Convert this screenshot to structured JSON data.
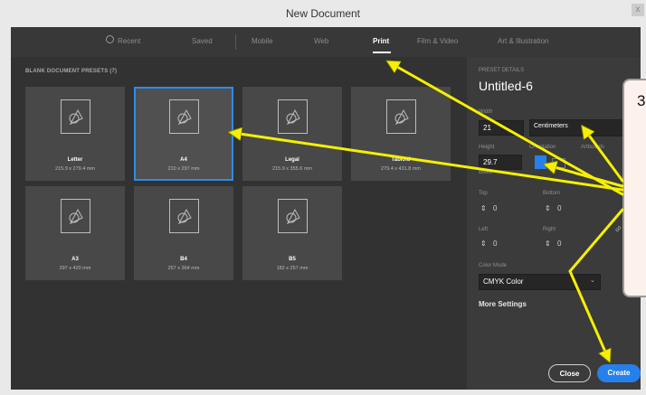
{
  "window": {
    "title": "New Document",
    "close_label": "x"
  },
  "tabs": [
    {
      "label": "Recent",
      "icon": "clock-icon"
    },
    {
      "label": "Saved"
    },
    {
      "label": "Mobile"
    },
    {
      "label": "Web"
    },
    {
      "label": "Print",
      "active": true
    },
    {
      "label": "Film & Video"
    },
    {
      "label": "Art & Illustration"
    }
  ],
  "presets": {
    "title": "BLANK DOCUMENT PRESETS (7)",
    "items": [
      {
        "name": "Letter",
        "dims": "215.9 x 279.4 mm"
      },
      {
        "name": "A4",
        "dims": "210 x 297 mm",
        "selected": true
      },
      {
        "name": "Legal",
        "dims": "215.9 x 355.6 mm"
      },
      {
        "name": "Tabloid",
        "dims": "279.4 x 431.8 mm"
      },
      {
        "name": "A3",
        "dims": "297 x 420 mm"
      },
      {
        "name": "B4",
        "dims": "257 x 364 mm"
      },
      {
        "name": "B5",
        "dims": "182 x 257 mm"
      }
    ]
  },
  "details": {
    "header": "PRESET DETAILS",
    "doc_name": "Untitled-6",
    "width_label": "Width",
    "width": "21",
    "units": "Centimeters",
    "height_label": "Height",
    "height": "29.7",
    "orientation_label": "Orientation",
    "artboards_label": "Artboards",
    "bleed_label": "Bleed",
    "top_label": "Top",
    "top": "0",
    "bottom_label": "Bottom",
    "bottom": "0",
    "left_label": "Left",
    "left": "0",
    "right_label": "Right",
    "right": "0",
    "color_mode_label": "Color Mode",
    "color_mode": "CMYK Color",
    "more_settings": "More Settings"
  },
  "callout": {
    "text": "3"
  },
  "actions": {
    "close": "Close",
    "create": "Create"
  },
  "colors": {
    "accent": "#2680eb",
    "arrow": "#f5f000"
  }
}
